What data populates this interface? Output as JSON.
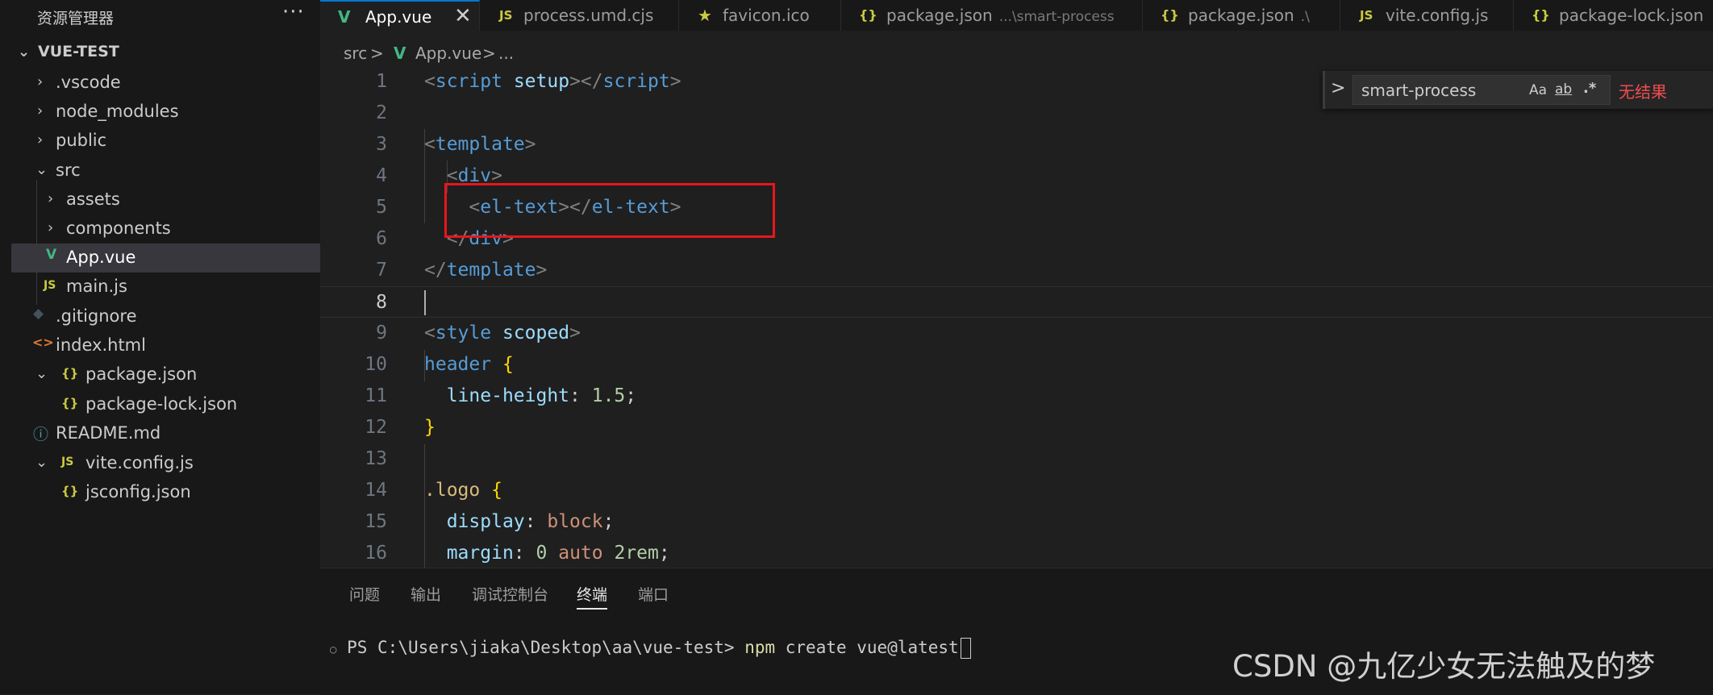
{
  "explorer": {
    "title": "资源管理器",
    "more": "···",
    "root": "VUE-TEST",
    "items": [
      {
        "label": ".vscode",
        "icon": "",
        "icon_name": "folder-closed"
      },
      {
        "label": "node_modules",
        "icon": "",
        "icon_name": "folder-closed"
      },
      {
        "label": "public",
        "icon": "",
        "icon_name": "folder-closed"
      },
      {
        "label": "src",
        "icon": "",
        "icon_name": "folder-open"
      },
      {
        "label": "assets",
        "icon": "",
        "icon_name": "folder-closed"
      },
      {
        "label": "components",
        "icon": "",
        "icon_name": "folder-closed"
      },
      {
        "label": "App.vue",
        "icon": "V",
        "icon_name": "vue-icon"
      },
      {
        "label": "main.js",
        "icon": "JS",
        "icon_name": "js-icon"
      },
      {
        "label": ".gitignore",
        "icon": "◆",
        "icon_name": "git-icon"
      },
      {
        "label": "index.html",
        "icon": "<>",
        "icon_name": "html-icon"
      },
      {
        "label": "package.json",
        "icon": "{}",
        "icon_name": "json-icon"
      },
      {
        "label": "package-lock.json",
        "icon": "{}",
        "icon_name": "json-icon"
      },
      {
        "label": "README.md",
        "icon": "ⓘ",
        "icon_name": "info-icon"
      },
      {
        "label": "vite.config.js",
        "icon": "JS",
        "icon_name": "js-icon"
      },
      {
        "label": "jsconfig.json",
        "icon": "{}",
        "icon_name": "json-icon"
      }
    ]
  },
  "tabs": [
    {
      "label": "App.vue",
      "icon": "V",
      "close": "✕"
    },
    {
      "label": "process.umd.cjs",
      "icon": "JS"
    },
    {
      "label": "favicon.ico",
      "icon": "★"
    },
    {
      "label": "package.json",
      "icon": "{}",
      "path": "...\\smart-process"
    },
    {
      "label": "package.json",
      "icon": "{}",
      "path": ".\\"
    },
    {
      "label": "vite.config.js",
      "icon": "JS"
    },
    {
      "label": "package-lock.json",
      "icon": "{}"
    }
  ],
  "breadcrumb": {
    "part1": "src",
    "sep1": ">",
    "icon": "V",
    "part2": "App.vue",
    "sep2": ">",
    "part3": "..."
  },
  "editor": {
    "line_numbers": [
      "1",
      "2",
      "3",
      "4",
      "5",
      "6",
      "7",
      "8",
      "9",
      "10",
      "11",
      "12",
      "13",
      "14",
      "15",
      "16"
    ],
    "current_line": "8"
  },
  "find": {
    "toggle": ">",
    "query": "smart-process",
    "opt_case": "Aa",
    "opt_word": "ab",
    "opt_regex": ".*",
    "result": "无结果"
  },
  "panel": {
    "tabs": [
      "问题",
      "输出",
      "调试控制台",
      "终端",
      "端口"
    ],
    "active_tab": "终端",
    "terminal_dot": "○",
    "terminal_prompt": "PS C:\\Users\\jiaka\\Desktop\\aa\\vue-test> ",
    "terminal_cmd": "npm",
    "terminal_args": " create vue@latest"
  },
  "watermark": "CSDN @九亿少女无法触及的梦",
  "colors": {
    "accent": "#0078d4",
    "highlight_box": "#e8161b",
    "no_result": "#f14c4c",
    "vue_green": "#41b883",
    "js_yellow": "#cbcb41"
  }
}
